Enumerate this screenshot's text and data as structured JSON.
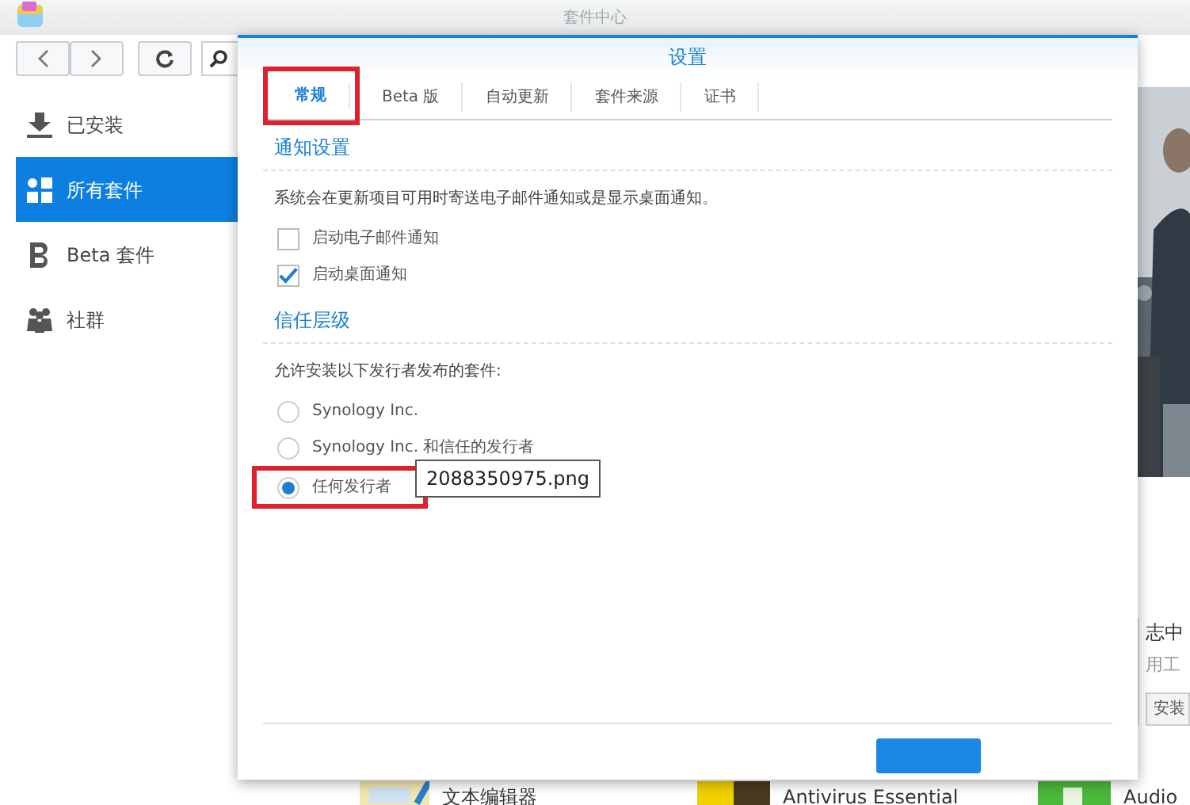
{
  "window": {
    "title": "套件中心"
  },
  "sidebar": {
    "items": [
      {
        "label": "已安装",
        "selected": false
      },
      {
        "label": "所有套件",
        "selected": true
      },
      {
        "label": "Beta 套件",
        "selected": false
      },
      {
        "label": "社群",
        "selected": false
      }
    ]
  },
  "background_card": {
    "title": "志中",
    "subtitle": "用工",
    "button": "安装"
  },
  "background_packages": [
    {
      "name": "文本编辑器"
    },
    {
      "name": "Antivirus Essential"
    },
    {
      "name": "Audio"
    }
  ],
  "dialog": {
    "title": "设置",
    "tabs": [
      {
        "label": "常规",
        "selected": true,
        "highlighted": true
      },
      {
        "label": "Beta 版",
        "selected": false,
        "highlighted": false
      },
      {
        "label": "自动更新",
        "selected": false,
        "highlighted": false
      },
      {
        "label": "套件来源",
        "selected": false,
        "highlighted": false
      },
      {
        "label": "证书",
        "selected": false,
        "highlighted": false
      }
    ],
    "sections": [
      {
        "title": "通知设置",
        "description": "系统会在更新项目可用时寄送电子邮件通知或是显示桌面通知。",
        "options": [
          {
            "kind": "checkbox",
            "label": "启动电子邮件通知",
            "checked": false,
            "highlighted": false
          },
          {
            "kind": "checkbox",
            "label": "启动桌面通知",
            "checked": true,
            "highlighted": false
          }
        ]
      },
      {
        "title": "信任层级",
        "description": "允许安装以下发行者发布的套件:",
        "options": [
          {
            "kind": "radio",
            "label": "Synology Inc.",
            "selected": false,
            "highlighted": false
          },
          {
            "kind": "radio",
            "label": "Synology Inc. 和信任的发行者",
            "selected": false,
            "highlighted": false
          },
          {
            "kind": "radio",
            "label": "任何发行者",
            "selected": true,
            "highlighted": true
          }
        ]
      }
    ]
  },
  "tooltip": {
    "text": "2088350975.png"
  }
}
